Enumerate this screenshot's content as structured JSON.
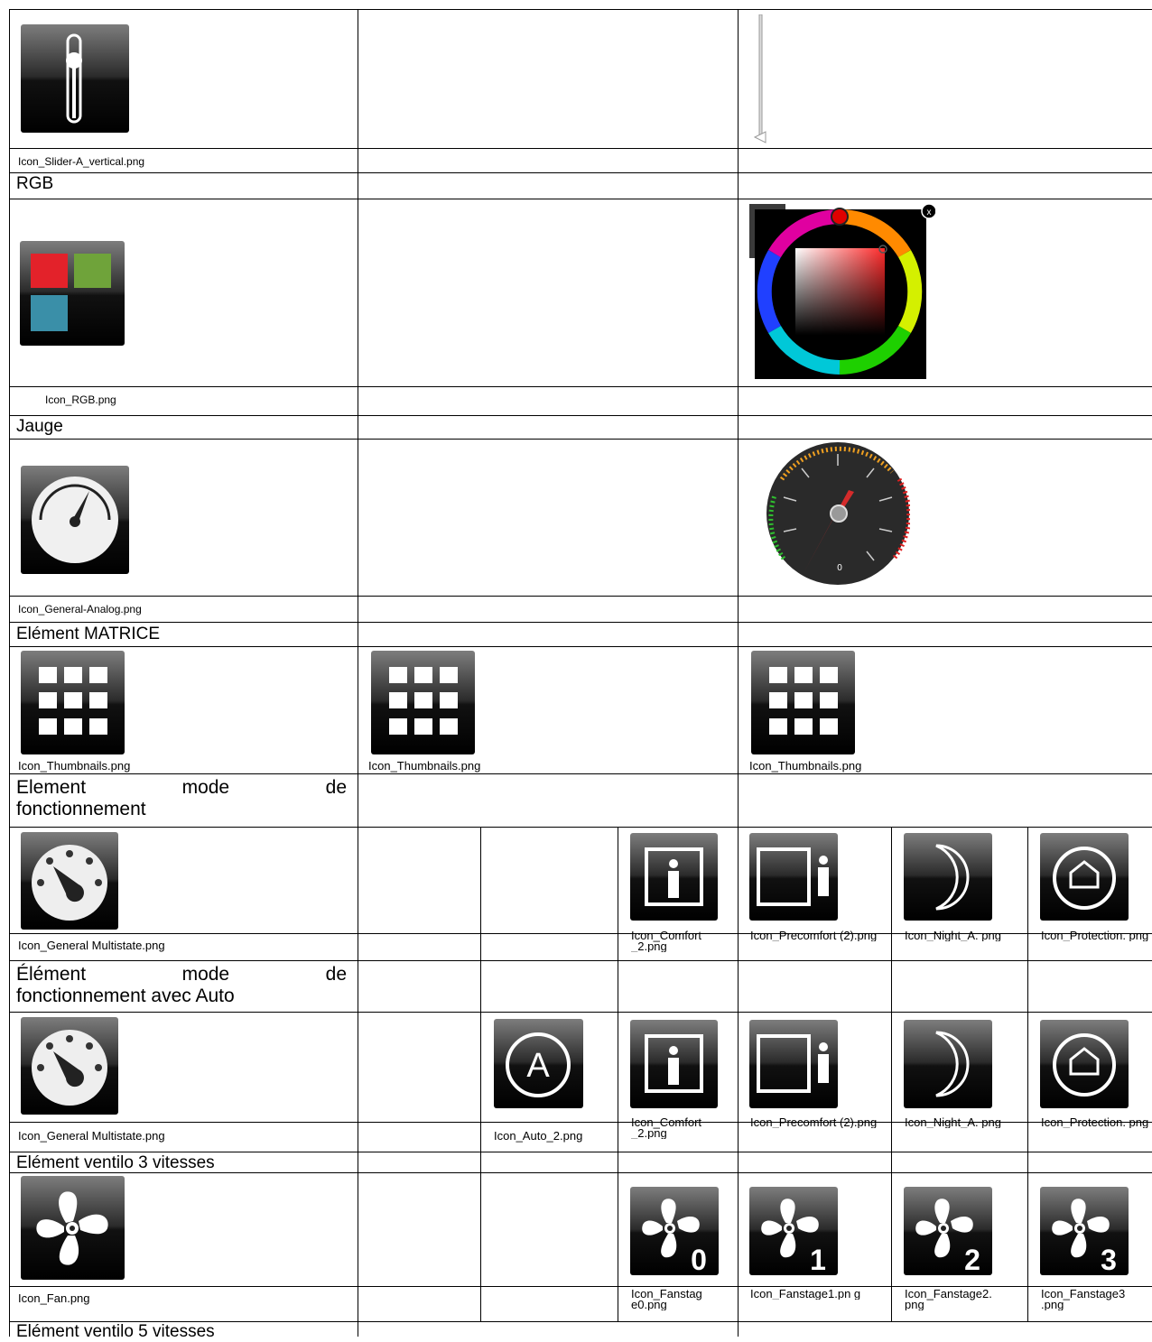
{
  "rows": {
    "slider": {
      "caption": "Icon_Slider-A_vertical.png"
    },
    "rgb": {
      "header": "RGB",
      "caption": "Icon_RGB.png",
      "picker_close": "x"
    },
    "gauge": {
      "header": "Jauge",
      "caption": "Icon_General-Analog.png",
      "gauge_value": "0"
    },
    "matrix": {
      "header": "Elément MATRICE",
      "captions": [
        "Icon_Thumbnails.png",
        "Icon_Thumbnails.png",
        "Icon_Thumbnails.png"
      ]
    },
    "mode": {
      "header_line1": [
        "Element",
        "mode",
        "de"
      ],
      "header_line2": "fonctionnement",
      "caption": "Icon_General Multistate.png",
      "icons": [
        "Icon_Comfort _2.png",
        "Icon_Precomfort (2).png",
        "Icon_Night_A. png",
        "Icon_Protection. png"
      ]
    },
    "mode_auto": {
      "header_line1": [
        "Élément",
        "mode",
        "de"
      ],
      "header_line2": "fonctionnement avec Auto",
      "caption": "Icon_General Multistate.png",
      "auto_caption": "Icon_Auto_2.png",
      "auto_letter": "A",
      "icons": [
        "Icon_Comfort _2.png",
        "Icon_Precomfort (2).png",
        "Icon_Night_A. png",
        "Icon_Protection. png"
      ]
    },
    "fan3": {
      "header": "Elément ventilo 3 vitesses",
      "caption": "Icon_Fan.png",
      "icons": [
        "Icon_Fanstag e0.png",
        "Icon_Fanstage1.pn g",
        "Icon_Fanstage2. png",
        "Icon_Fanstage3 .png"
      ],
      "digits": [
        "0",
        "1",
        "2",
        "3"
      ]
    },
    "fan5": {
      "header": "Elément ventilo 5 vitesses"
    }
  },
  "colors": {
    "rgb_red": "#e3222a",
    "rgb_green": "#6fa33a",
    "rgb_blue": "#3a8fa8",
    "gauge_needle": "#d42b2b"
  }
}
